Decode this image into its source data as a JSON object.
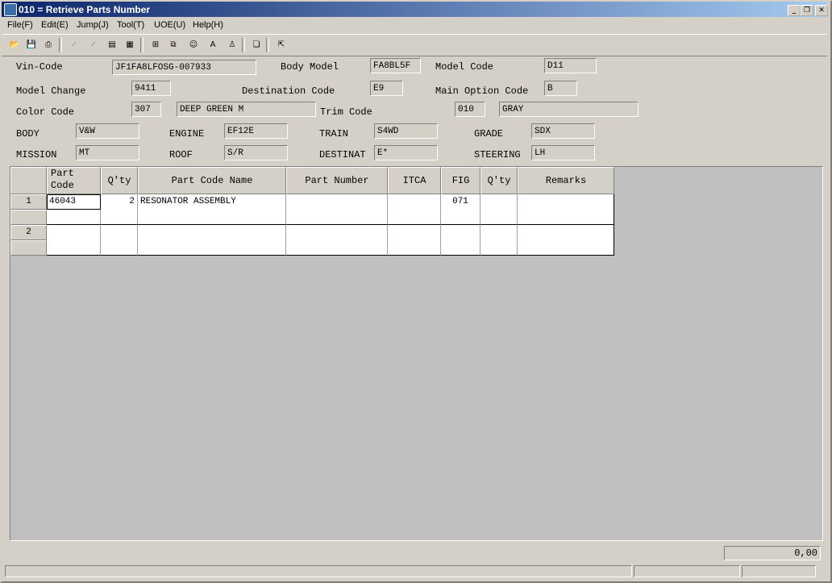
{
  "window": {
    "title": "010 = Retrieve Parts Number"
  },
  "menu": [
    "File(F)",
    "Edit(E)",
    "Jump(J)",
    "Tool(T)",
    "UOE(U)",
    "Help(H)"
  ],
  "toolbar": {
    "icons": [
      "open-folder-icon",
      "save-icon",
      "print-icon",
      "check-123-icon",
      "check-009-icon",
      "export-icon",
      "report-icon",
      "grid-icon",
      "copy-window-icon",
      "person-search-icon",
      "text-edit-icon",
      "user-icon",
      "document-copy-icon",
      "exit-icon"
    ]
  },
  "header": {
    "vin_label": "Vin-Code",
    "vin": "JF1FA8LFOSG-007933",
    "body_model_label": "Body Model",
    "body_model": "FA8BL5F",
    "model_code_label": "Model Code",
    "model_code": "D11",
    "model_change_label": "Model Change",
    "model_change": "9411",
    "destination_code_label": "Destination Code",
    "destination_code": "E9",
    "main_option_label": "Main Option Code",
    "main_option": "B",
    "color_code_label": "Color Code",
    "color_code": "307",
    "color_name": "DEEP GREEN M",
    "trim_code_label": "Trim Code",
    "trim_code": "010",
    "trim_name": "GRAY",
    "body_label": "BODY",
    "body": "V&W",
    "engine_label": "ENGINE",
    "engine": "EF12E",
    "train_label": "TRAIN",
    "train": "S4WD",
    "grade_label": "GRADE",
    "grade": "SDX",
    "mission_label": "MISSION",
    "mission": "MT",
    "roof_label": "ROOF",
    "roof": "S/R",
    "destinat_label": "DESTINAT",
    "destinat": "E*",
    "steering_label": "STEERING",
    "steering": "LH"
  },
  "grid": {
    "columns": [
      "Part Code",
      "Q'ty",
      "Part Code Name",
      "Part Number",
      "ITCA",
      "FIG",
      "Q'ty",
      "Remarks"
    ],
    "rows": [
      {
        "num": "1",
        "part_code": "46043",
        "qty": "2",
        "name": "RESONATOR ASSEMBLY",
        "part_number": "",
        "itca": "",
        "fig": "071",
        "qty2": "",
        "remarks": ""
      },
      {
        "num": "2",
        "part_code": "",
        "qty": "",
        "name": "",
        "part_number": "",
        "itca": "",
        "fig": "",
        "qty2": "",
        "remarks": ""
      }
    ]
  },
  "total": "0,00"
}
